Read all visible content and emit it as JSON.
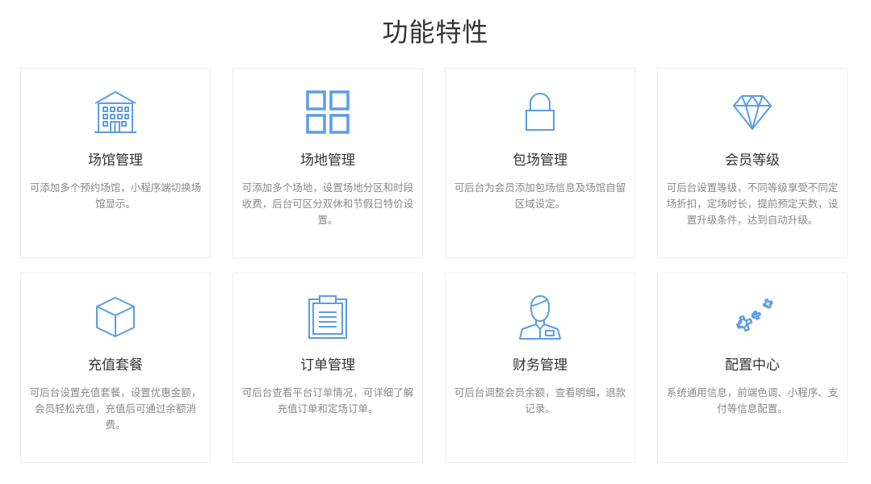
{
  "page_title": "功能特性",
  "accent_color": "#5c9ce6",
  "features": [
    {
      "title": "场馆管理",
      "desc": "可添加多个预约场馆，小程序端切换场馆显示。",
      "icon": "building-icon"
    },
    {
      "title": "场地管理",
      "desc": "可添加多个场地，设置场地分区和时段收费，后台可区分双休和节假日特价设置。",
      "icon": "grid-icon"
    },
    {
      "title": "包场管理",
      "desc": "可后台为会员添加包场信息及场馆自留区域设定。",
      "icon": "lock-icon"
    },
    {
      "title": "会员等级",
      "desc": "可后台设置等级，不同等级享受不同定场折扣，定场时长，提前预定天数，设置升级条件，达到自动升级。",
      "icon": "diamond-icon"
    },
    {
      "title": "充值套餐",
      "desc": "可后台设置充值套餐，设置优惠金额，会员轻松充值，充值后可通过余额消费。",
      "icon": "box-icon"
    },
    {
      "title": "订单管理",
      "desc": "可后台查看平台订单情况，可详细了解充值订单和定场订单。",
      "icon": "clipboard-icon"
    },
    {
      "title": "财务管理",
      "desc": "可后台调整会员余额，查看明细，退款记录。",
      "icon": "staff-icon"
    },
    {
      "title": "配置中心",
      "desc": "系统通用信息，前端色调、小程序、支付等信息配置。",
      "icon": "gears-icon"
    }
  ]
}
